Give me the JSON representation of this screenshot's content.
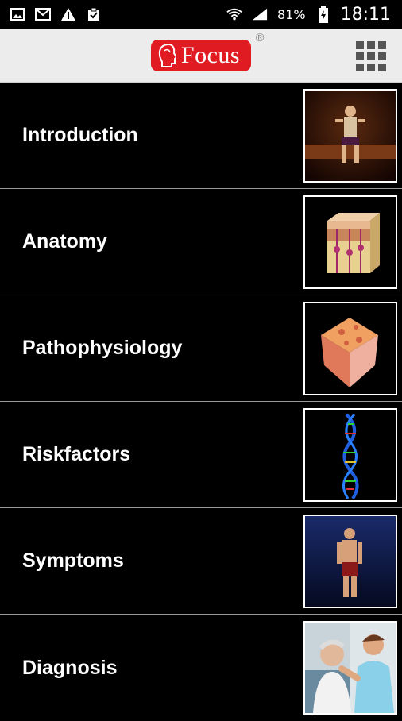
{
  "status_bar": {
    "icons": [
      "image-icon",
      "gmail-icon",
      "warning-icon",
      "clipboard-check-icon",
      "wifi-icon",
      "signal-icon",
      "battery-charging-icon"
    ],
    "battery": "81%",
    "time": "18:11"
  },
  "app_bar": {
    "logo_text": "Focus",
    "registered_mark": "®",
    "brand_color": "#e11b22",
    "menu_icon": "apps-grid-icon"
  },
  "menu": {
    "items": [
      {
        "label": "Introduction",
        "thumbnail": "seated-man-thumbnail"
      },
      {
        "label": "Anatomy",
        "thumbnail": "skin-layers-thumbnail"
      },
      {
        "label": "Pathophysiology",
        "thumbnail": "skin-cube-thumbnail"
      },
      {
        "label": "Riskfactors",
        "thumbnail": "dna-helix-thumbnail"
      },
      {
        "label": "Symptoms",
        "thumbnail": "standing-man-thumbnail"
      },
      {
        "label": "Diagnosis",
        "thumbnail": "doctor-patient-thumbnail"
      }
    ]
  }
}
